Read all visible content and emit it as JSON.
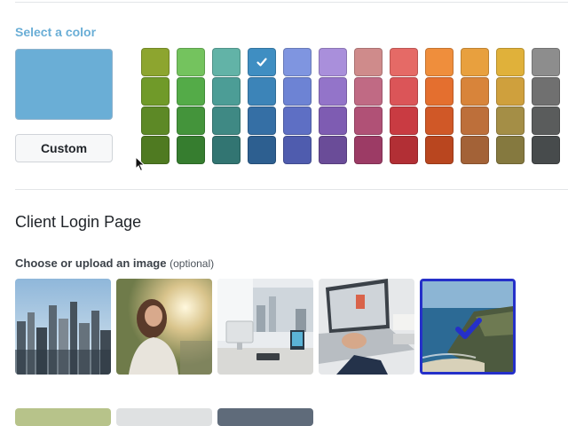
{
  "color_section": {
    "label": "Select a color",
    "preview_color": "#6aaed6",
    "custom_button_label": "Custom",
    "selected_swatch": "#3f8ec2",
    "swatch_columns": [
      [
        "#8da52f",
        "#709a29",
        "#5d8926",
        "#4f7a21"
      ],
      [
        "#74c35e",
        "#54ab48",
        "#44943b",
        "#367d2f"
      ],
      [
        "#62b3a7",
        "#4c9d96",
        "#3f8984",
        "#327572"
      ],
      [
        "#3f8ec2",
        "#3c84b8",
        "#356fa5",
        "#2d5f90"
      ],
      [
        "#7f95e0",
        "#6d83d4",
        "#5e6fc4",
        "#4f5cae"
      ],
      [
        "#a98fdb",
        "#9374c9",
        "#7e5cb2",
        "#6a4c98"
      ],
      [
        "#cf8b8b",
        "#c06a84",
        "#b05176",
        "#9c3b65"
      ],
      [
        "#e56a66",
        "#db5558",
        "#c93b42",
        "#b22f35"
      ],
      [
        "#ef8e3c",
        "#e46f2f",
        "#d05827",
        "#b9461f"
      ],
      [
        "#e8a03e",
        "#d8843a",
        "#bd6f3a",
        "#a36237"
      ],
      [
        "#e0b13a",
        "#cfa03d",
        "#a48e46",
        "#85793f"
      ],
      [
        "#8d8d8d",
        "#707070",
        "#5a5c5c",
        "#474b4c"
      ]
    ]
  },
  "login_page": {
    "title": "Client Login Page",
    "image_label": "Choose or upload an image",
    "image_label_optional": "(optional)",
    "images": [
      {
        "name": "city-skyline",
        "selected": false
      },
      {
        "name": "woman-sunlight",
        "selected": false
      },
      {
        "name": "office-desk",
        "selected": false
      },
      {
        "name": "laptop-typing",
        "selected": false
      },
      {
        "name": "coastline-aerial",
        "selected": true
      }
    ]
  },
  "icons": {
    "check": "check-icon",
    "cursor": "mouse-cursor-icon"
  }
}
